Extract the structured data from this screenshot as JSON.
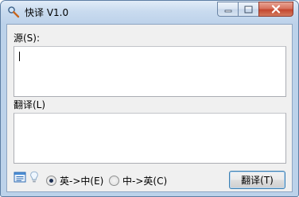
{
  "window": {
    "title": "快译 V1.0",
    "icon": "magnifier-icon"
  },
  "caption": {
    "minimize": "minimize-icon",
    "maximize": "maximize-icon",
    "close": "close-icon"
  },
  "source": {
    "label": "源(S):",
    "value": ""
  },
  "translation": {
    "label": "翻译(L)",
    "value": ""
  },
  "bottom": {
    "icons": [
      "menu-icon",
      "lightbulb-icon"
    ],
    "direction_options": [
      {
        "label": "英->中(E)",
        "checked": true
      },
      {
        "label": "中->英(C)",
        "checked": false
      }
    ],
    "translate_button": "翻译(T)"
  },
  "colors": {
    "accent": "#3c7fb1",
    "client_bg": "#f0f0f0",
    "close_red": "#c4472f"
  }
}
